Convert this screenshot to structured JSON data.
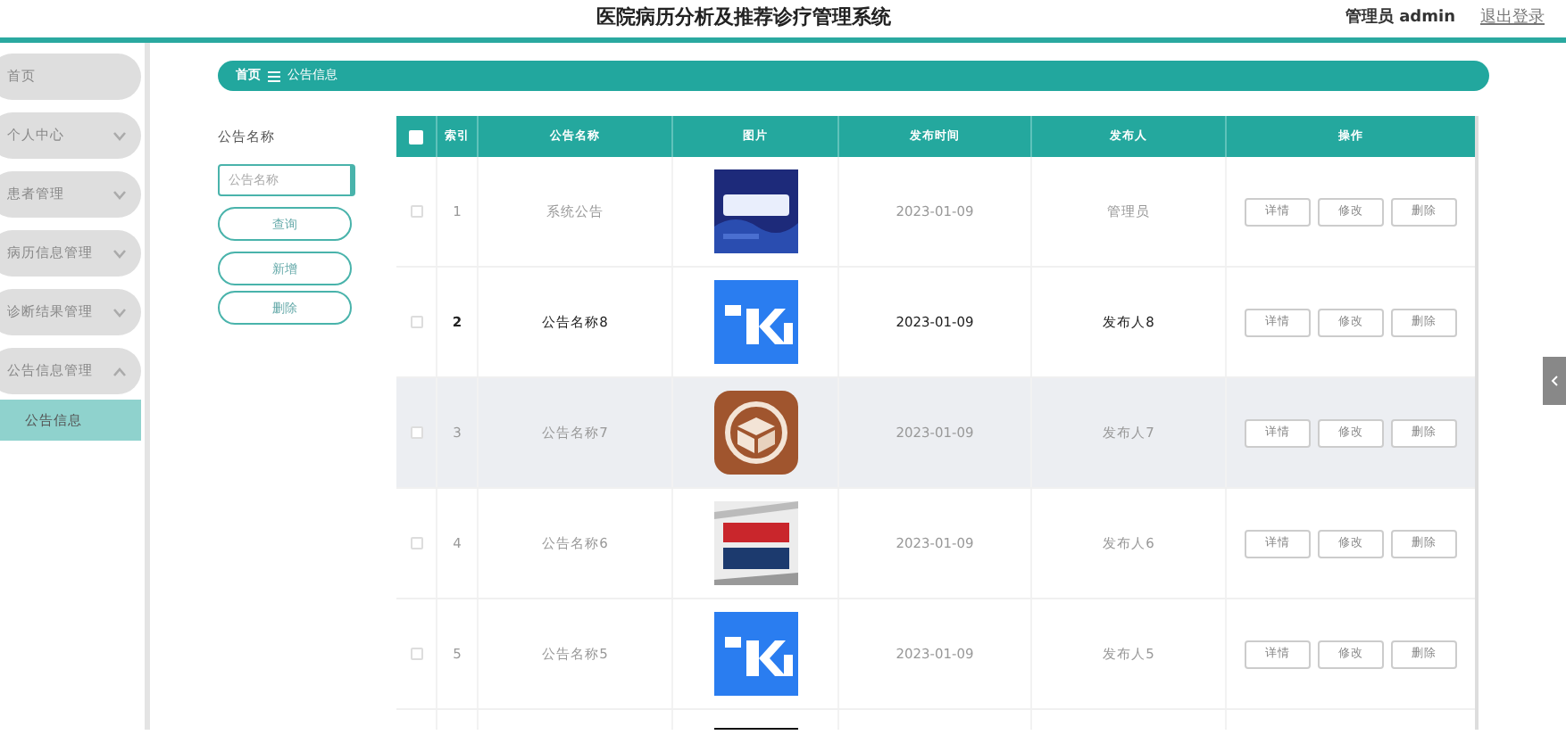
{
  "header": {
    "title": "医院病历分析及推荐诊疗管理系统",
    "user": "管理员 admin",
    "logout": "退出登录"
  },
  "sidebar": {
    "items": [
      {
        "label": "首页"
      },
      {
        "label": "个人中心",
        "expanded": false
      },
      {
        "label": "患者管理",
        "expanded": false
      },
      {
        "label": "病历信息管理",
        "expanded": false
      },
      {
        "label": "诊断结果管理",
        "expanded": false
      },
      {
        "label": "公告信息管理",
        "expanded": true,
        "children": [
          {
            "label": "公告信息",
            "selected": true
          }
        ]
      }
    ]
  },
  "breadcrumb": [
    "首页",
    "公告信息"
  ],
  "search": {
    "label": "公告名称",
    "placeholder": "公告名称",
    "buttons": [
      "查询",
      "新增",
      "删除"
    ]
  },
  "table": {
    "columns": [
      "索引",
      "公告名称",
      "图片",
      "发布时间",
      "发布人",
      "操作"
    ],
    "select_all_checked": false,
    "rows": [
      {
        "index": "1",
        "name": "系统公告",
        "date": "2023-01-09",
        "author": "管理员",
        "checked": false,
        "hovered": false,
        "shaded": false,
        "actions": [
          "详情",
          "修改",
          "删除"
        ]
      },
      {
        "index": "2",
        "name": "公告名称8",
        "date": "2023-01-09",
        "author": "发布人8",
        "checked": false,
        "hovered": true,
        "shaded": false,
        "actions": [
          "详情",
          "修改",
          "删除"
        ]
      },
      {
        "index": "3",
        "name": "公告名称7",
        "date": "2023-01-09",
        "author": "发布人7",
        "checked": false,
        "hovered": false,
        "shaded": true,
        "actions": [
          "详情",
          "修改",
          "删除"
        ]
      },
      {
        "index": "4",
        "name": "公告名称6",
        "date": "2023-01-09",
        "author": "发布人6",
        "checked": false,
        "hovered": false,
        "shaded": false,
        "actions": [
          "详情",
          "修改",
          "删除"
        ]
      },
      {
        "index": "5",
        "name": "公告名称5",
        "date": "2023-01-09",
        "author": "发布人5",
        "checked": false,
        "hovered": false,
        "shaded": false,
        "actions": [
          "详情",
          "修改",
          "删除"
        ]
      },
      {
        "cut": true
      }
    ]
  }
}
